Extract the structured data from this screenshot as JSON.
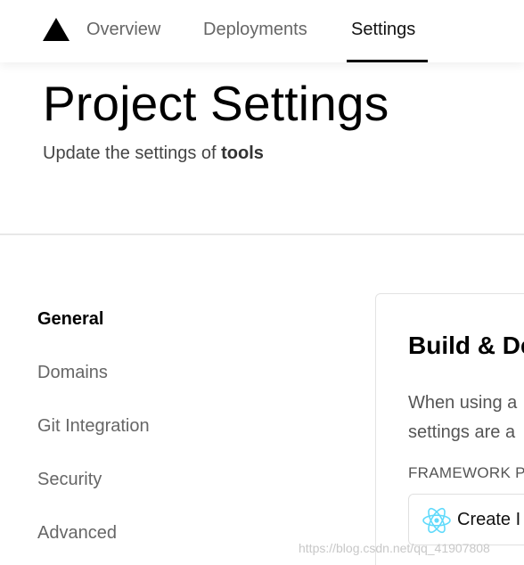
{
  "nav": {
    "items": [
      {
        "label": "Overview"
      },
      {
        "label": "Deployments"
      },
      {
        "label": "Settings"
      }
    ],
    "active": "Settings"
  },
  "header": {
    "title": "Project Settings",
    "subtitle_prefix": "Update the settings of ",
    "project_name": "tools"
  },
  "sidebar": {
    "items": [
      {
        "label": "General"
      },
      {
        "label": "Domains"
      },
      {
        "label": "Git Integration"
      },
      {
        "label": "Security"
      },
      {
        "label": "Advanced"
      }
    ],
    "active": "General"
  },
  "card": {
    "title": "Build & De",
    "desc_line1": "When using a",
    "desc_line2": "settings are a",
    "field_label": "FRAMEWORK P",
    "framework_value": "Create I",
    "framework_icon": "react-icon"
  },
  "watermark": "https://blog.csdn.net/qq_41907808",
  "colors": {
    "accent": "#000000",
    "react": "#61dafb",
    "muted_text": "#666666"
  }
}
